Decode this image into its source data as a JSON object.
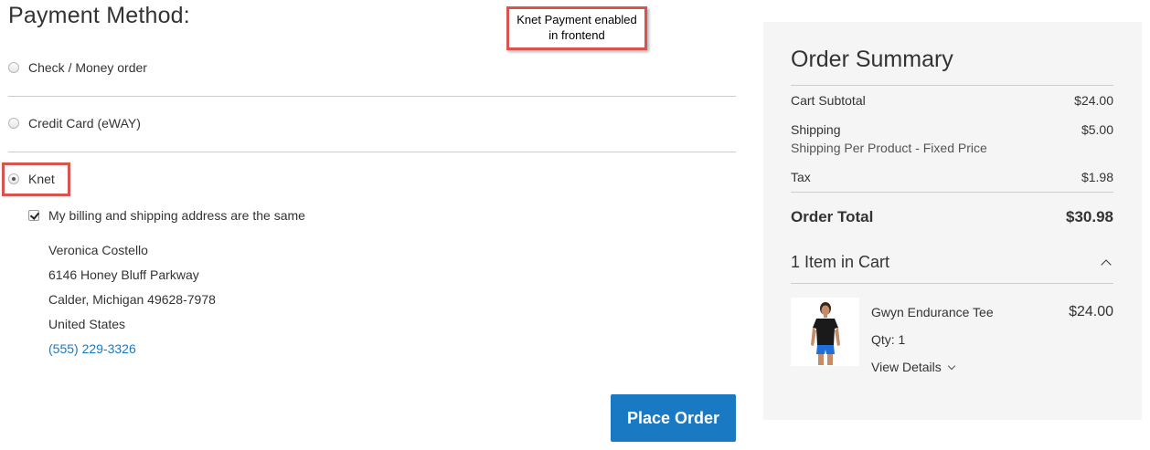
{
  "payment": {
    "title": "Payment Method:",
    "methods": [
      {
        "label": "Check / Money order",
        "checked": false
      },
      {
        "label": "Credit Card (eWAY)",
        "checked": false
      },
      {
        "label": "Knet",
        "checked": true
      }
    ],
    "billing_same_label": "My billing and shipping address are the same",
    "billing_same_checked": true,
    "address": {
      "name": "Veronica Costello",
      "street": "6146 Honey Bluff Parkway",
      "city_line": "Calder, Michigan 49628-7978",
      "country": "United States",
      "phone": "(555) 229-3326"
    },
    "place_order_label": "Place Order"
  },
  "annotation": {
    "line1": "Knet Payment enabled",
    "line2": "in frontend"
  },
  "summary": {
    "title": "Order Summary",
    "subtotal_label": "Cart Subtotal",
    "subtotal_value": "$24.00",
    "shipping_label": "Shipping",
    "shipping_value": "$5.00",
    "shipping_method": "Shipping Per Product - Fixed Price",
    "tax_label": "Tax",
    "tax_value": "$1.98",
    "total_label": "Order Total",
    "total_value": "$30.98",
    "items_header": "1 Item in Cart",
    "item": {
      "name": "Gwyn Endurance Tee",
      "price": "$24.00",
      "qty": "Qty: 1",
      "view_details": "View Details"
    }
  },
  "colors": {
    "accent": "#1979c3",
    "annotation_border": "#d9534f",
    "summary_bg": "#f5f5f5"
  }
}
